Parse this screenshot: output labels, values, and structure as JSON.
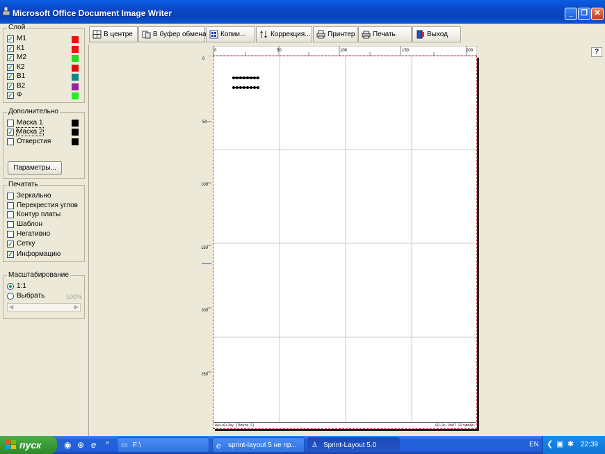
{
  "window": {
    "title": "Microsoft Office Document Image Writer"
  },
  "layers": {
    "title": "Слой",
    "items": [
      {
        "label": "М1",
        "checked": true,
        "color": "#ee1111"
      },
      {
        "label": "К1",
        "checked": true,
        "color": "#ee1111"
      },
      {
        "label": "М2",
        "checked": true,
        "color": "#22dd22"
      },
      {
        "label": "К2",
        "checked": true,
        "color": "#dd1111"
      },
      {
        "label": "В1",
        "checked": true,
        "color": "#118888"
      },
      {
        "label": "В2",
        "checked": true,
        "color": "#992299"
      },
      {
        "label": "Ф",
        "checked": true,
        "color": "#22ee22"
      }
    ]
  },
  "extra": {
    "title": "Дополнительно",
    "items": [
      {
        "label": "Маска 1",
        "checked": false,
        "color": "#000000"
      },
      {
        "label": "Маска 2",
        "checked": true,
        "color": "#000000"
      },
      {
        "label": "Отверстия",
        "checked": false,
        "color": "#000000"
      }
    ],
    "params_label": "Параметры..."
  },
  "print": {
    "title": "Печатать",
    "items": [
      {
        "label": "Зеркально",
        "checked": false
      },
      {
        "label": "Перекрестия углов",
        "checked": false
      },
      {
        "label": "Контур платы",
        "checked": false
      },
      {
        "label": "Шаблон",
        "checked": false
      },
      {
        "label": "Негативно",
        "checked": false
      },
      {
        "label": "Сетку",
        "checked": true
      },
      {
        "label": "Информацию",
        "checked": true
      }
    ]
  },
  "scale": {
    "title": "Масштабирование",
    "opt1": "1:1",
    "opt2": "Выбрать",
    "percent": "100%",
    "selected": "1:1"
  },
  "toolbar": {
    "center": "В центре",
    "clipboard": "В буфер обмена",
    "copies": "Копии...",
    "correction": "Коррекция...",
    "printer": "Принтер",
    "print": "Печать",
    "exit": "Выход",
    "help": "?"
  },
  "ruler": {
    "top": [
      "0",
      "50",
      "100",
      "150",
      "200"
    ],
    "left": [
      "0",
      "50",
      "100",
      "150",
      "200",
      "250"
    ]
  },
  "page": {
    "footer_left": "8A1+0+Jay (Плата 2)",
    "footer_right": "02.0+.2007 22:мин0+"
  },
  "taskbar": {
    "start": "пуск",
    "tasks": [
      "F:\\",
      "sprint-layout 5 не пр...",
      "Sprint-Layout 5.0"
    ],
    "lang": "EN",
    "time": "22:39"
  }
}
